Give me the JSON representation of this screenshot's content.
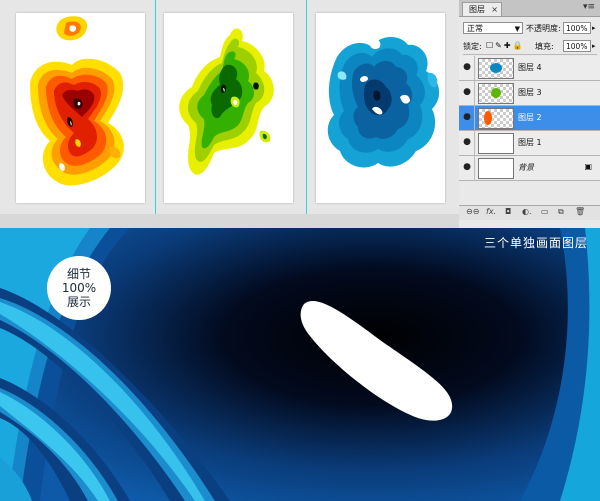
{
  "layers_panel": {
    "tab_label": "图层",
    "tab_close": "×",
    "menu_glyph": "▾≡",
    "blend_mode": "正常",
    "opacity_label": "不透明度:",
    "opacity_value": "100%",
    "lock_label": "锁定:",
    "lock_icons": "☐✎✚🔒",
    "fill_label": "填充:",
    "fill_value": "100%",
    "layers": [
      {
        "name": "图层 4",
        "visible": true,
        "selected": false
      },
      {
        "name": "图层 3",
        "visible": true,
        "selected": false
      },
      {
        "name": "图层 2",
        "visible": true,
        "selected": true
      },
      {
        "name": "图层 1",
        "visible": true,
        "selected": false
      },
      {
        "name": "背景",
        "visible": true,
        "selected": false,
        "locked": true
      }
    ],
    "bottom_icons": [
      "link-icon",
      "fx-icon",
      "mask-icon",
      "adjustment-icon",
      "group-icon",
      "new-layer-icon",
      "trash-icon"
    ],
    "bottom_glyphs": {
      "link": "⊖⊖",
      "fx": "fx.",
      "mask": "◘",
      "adjust": "◐.",
      "group": "▭",
      "newl": "⧉",
      "trash": "🗑"
    }
  },
  "detail": {
    "caption": "三个单独画面图层",
    "badge_line1": "细节",
    "badge_line2": "100%",
    "badge_line3": "展示"
  },
  "colors": {
    "selected_layer": "#3d8ee8",
    "guide": "#30d5d5",
    "detail_dark": "#02091c",
    "detail_cyan": "#0aa9da"
  }
}
